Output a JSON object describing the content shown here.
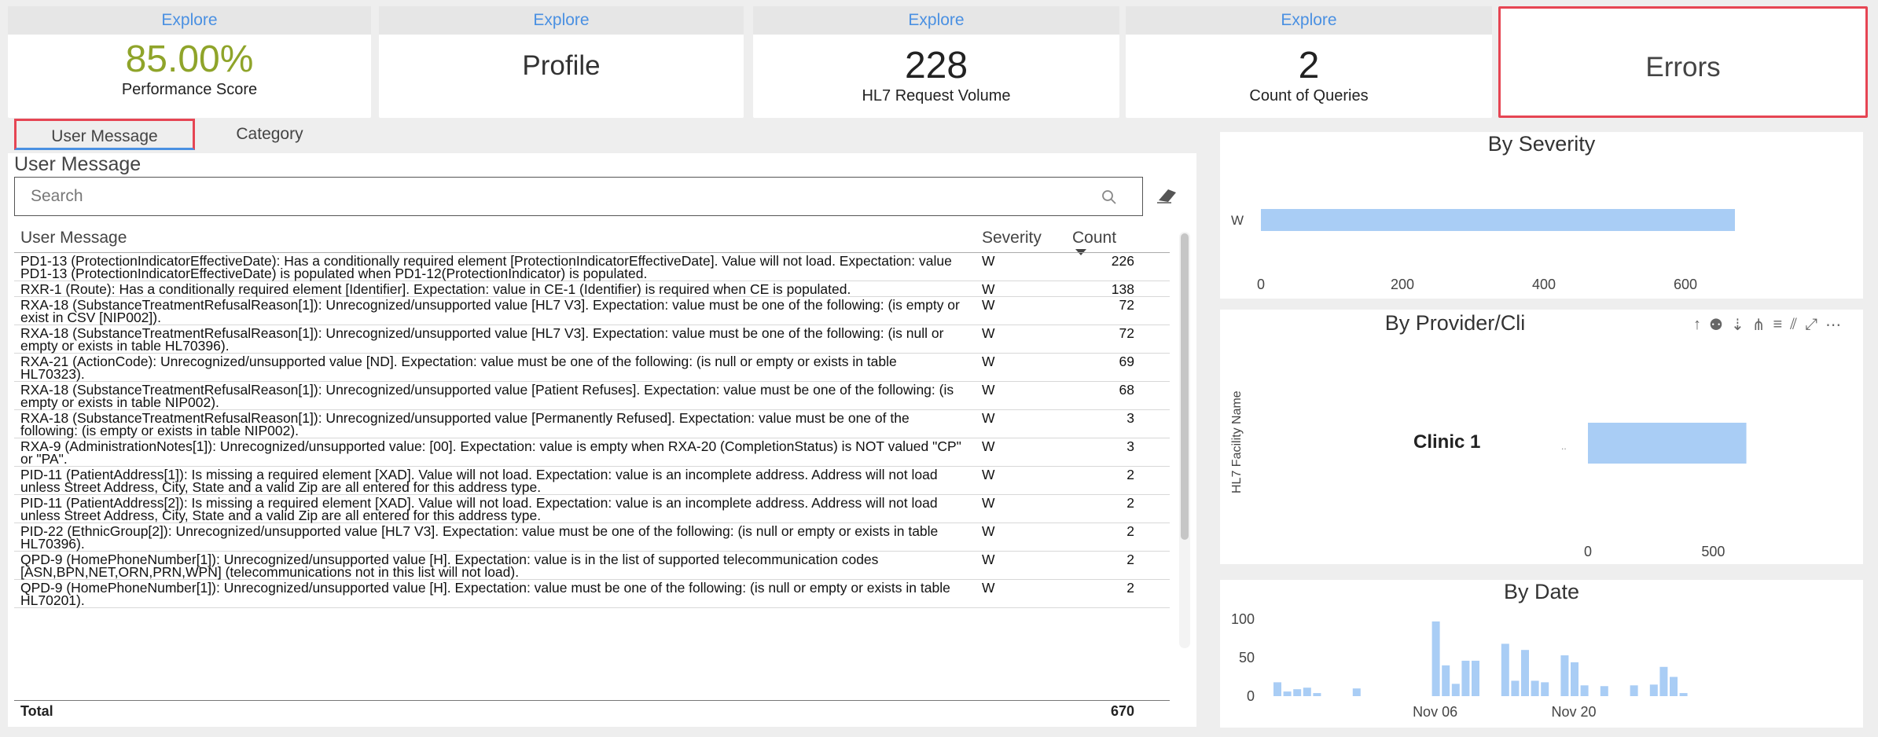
{
  "kpis": {
    "performance": {
      "explore": "Explore",
      "value": "85.00%",
      "label": "Performance Score"
    },
    "profile": {
      "explore": "Explore",
      "value": "Profile"
    },
    "requests": {
      "explore": "Explore",
      "value": "228",
      "label": "HL7 Request Volume"
    },
    "queries": {
      "explore": "Explore",
      "value": "2",
      "label": "Count of Queries"
    },
    "errors": {
      "value": "Errors"
    }
  },
  "tabs": {
    "user_message": "User Message",
    "category": "Category"
  },
  "left_panel": {
    "title": "User Message",
    "search_placeholder": "Search",
    "columns": {
      "message": "User Message",
      "severity": "Severity",
      "count": "Count"
    },
    "rows": [
      {
        "message": "PD1-13 (ProtectionIndicatorEffectiveDate): Has a conditionally required element [ProtectionIndicatorEffectiveDate]. Value will not load. Expectation: value PD1-13 (ProtectionIndicatorEffectiveDate) is populated when PD1-12(ProtectionIndicator) is populated.",
        "severity": "W",
        "count": "226"
      },
      {
        "message": "RXR-1 (Route): Has a conditionally required element [Identifier]. Expectation: value in CE-1 (Identifier) is required when CE is populated.",
        "severity": "W",
        "count": "138"
      },
      {
        "message": "RXA-18 (SubstanceTreatmentRefusalReason[1]): Unrecognized/unsupported value [HL7 V3]. Expectation: value must be one of the following: (is empty or exist in CSV [NIP002]).",
        "severity": "W",
        "count": "72"
      },
      {
        "message": "RXA-18 (SubstanceTreatmentRefusalReason[1]): Unrecognized/unsupported value [HL7 V3]. Expectation: value must be one of the following: (is null or empty or exists in table HL70396).",
        "severity": "W",
        "count": "72"
      },
      {
        "message": "RXA-21 (ActionCode): Unrecognized/unsupported value [ND]. Expectation: value must be one of the following: (is null or empty or exists in table HL70323).",
        "severity": "W",
        "count": "69"
      },
      {
        "message": "RXA-18 (SubstanceTreatmentRefusalReason[1]): Unrecognized/unsupported value [Patient Refuses]. Expectation: value must be one of the following: (is empty or exists in table NIP002).",
        "severity": "W",
        "count": "68"
      },
      {
        "message": "RXA-18 (SubstanceTreatmentRefusalReason[1]): Unrecognized/unsupported value [Permanently Refused]. Expectation: value must be one of the following: (is empty or exists in table NIP002).",
        "severity": "W",
        "count": "3"
      },
      {
        "message": "RXA-9 (AdministrationNotes[1]): Unrecognized/unsupported value: [00]. Expectation: value is empty when RXA-20 (CompletionStatus) is NOT valued \"CP\" or \"PA\".",
        "severity": "W",
        "count": "3"
      },
      {
        "message": "PID-11 (PatientAddress[1]): Is missing a required element [XAD]. Value will not load. Expectation: value is an incomplete address. Address will not load unless Street Address, City, State and a valid Zip are all entered for this address type.",
        "severity": "W",
        "count": "2"
      },
      {
        "message": "PID-11 (PatientAddress[2]): Is missing a required element [XAD]. Value will not load. Expectation: value is an incomplete address. Address will not load unless Street Address, City, State and a valid Zip are all entered for this address type.",
        "severity": "W",
        "count": "2"
      },
      {
        "message": "PID-22 (EthnicGroup[2]): Unrecognized/unsupported value [HL7 V3]. Expectation: value must be one of the following: (is null or empty or exists in table HL70396).",
        "severity": "W",
        "count": "2"
      },
      {
        "message": "QPD-9 (HomePhoneNumber[1]): Unrecognized/unsupported value [H]. Expectation: value is in the list of supported telecommunication codes [ASN,BPN,NET,ORN,PRN,WPN] (telecommunications not in this list will not load).",
        "severity": "W",
        "count": "2"
      },
      {
        "message": "QPD-9 (HomePhoneNumber[1]): Unrecognized/unsupported value [H]. Expectation: value must be one of the following: (is null or empty or exists in table HL70201).",
        "severity": "W",
        "count": "2"
      }
    ],
    "total_label": "Total",
    "total_value": "670"
  },
  "severity_chart": {
    "title": "By Severity",
    "categories": [
      "W"
    ],
    "values": [
      670
    ],
    "ticks": [
      "0",
      "200",
      "400",
      "600"
    ],
    "xlim": [
      0,
      700
    ],
    "color": "#a9cdf5"
  },
  "provider_chart": {
    "title": "By Provider/Cli",
    "ylabel": "HL7 Facility Name",
    "categories": [
      "Clinic 1"
    ],
    "values": [
      670
    ],
    "ticks": [
      "0",
      "500"
    ],
    "xlim": [
      0,
      800
    ],
    "color": "#a9cdf5"
  },
  "date_chart": {
    "title": "By Date",
    "yticks": [
      "100",
      "50",
      "0"
    ],
    "xticks": [
      "Nov 06",
      "Nov 20"
    ],
    "ylim": [
      0,
      100
    ],
    "values": [
      18,
      6,
      9,
      11,
      4,
      0,
      0,
      0,
      10,
      0,
      0,
      0,
      0,
      0,
      0,
      0,
      97,
      40,
      16,
      46,
      46,
      0,
      0,
      68,
      20,
      60,
      20,
      18,
      0,
      53,
      44,
      14,
      0,
      13,
      0,
      0,
      14,
      0,
      15,
      38,
      25,
      4
    ],
    "color": "#a9cdf5"
  }
}
